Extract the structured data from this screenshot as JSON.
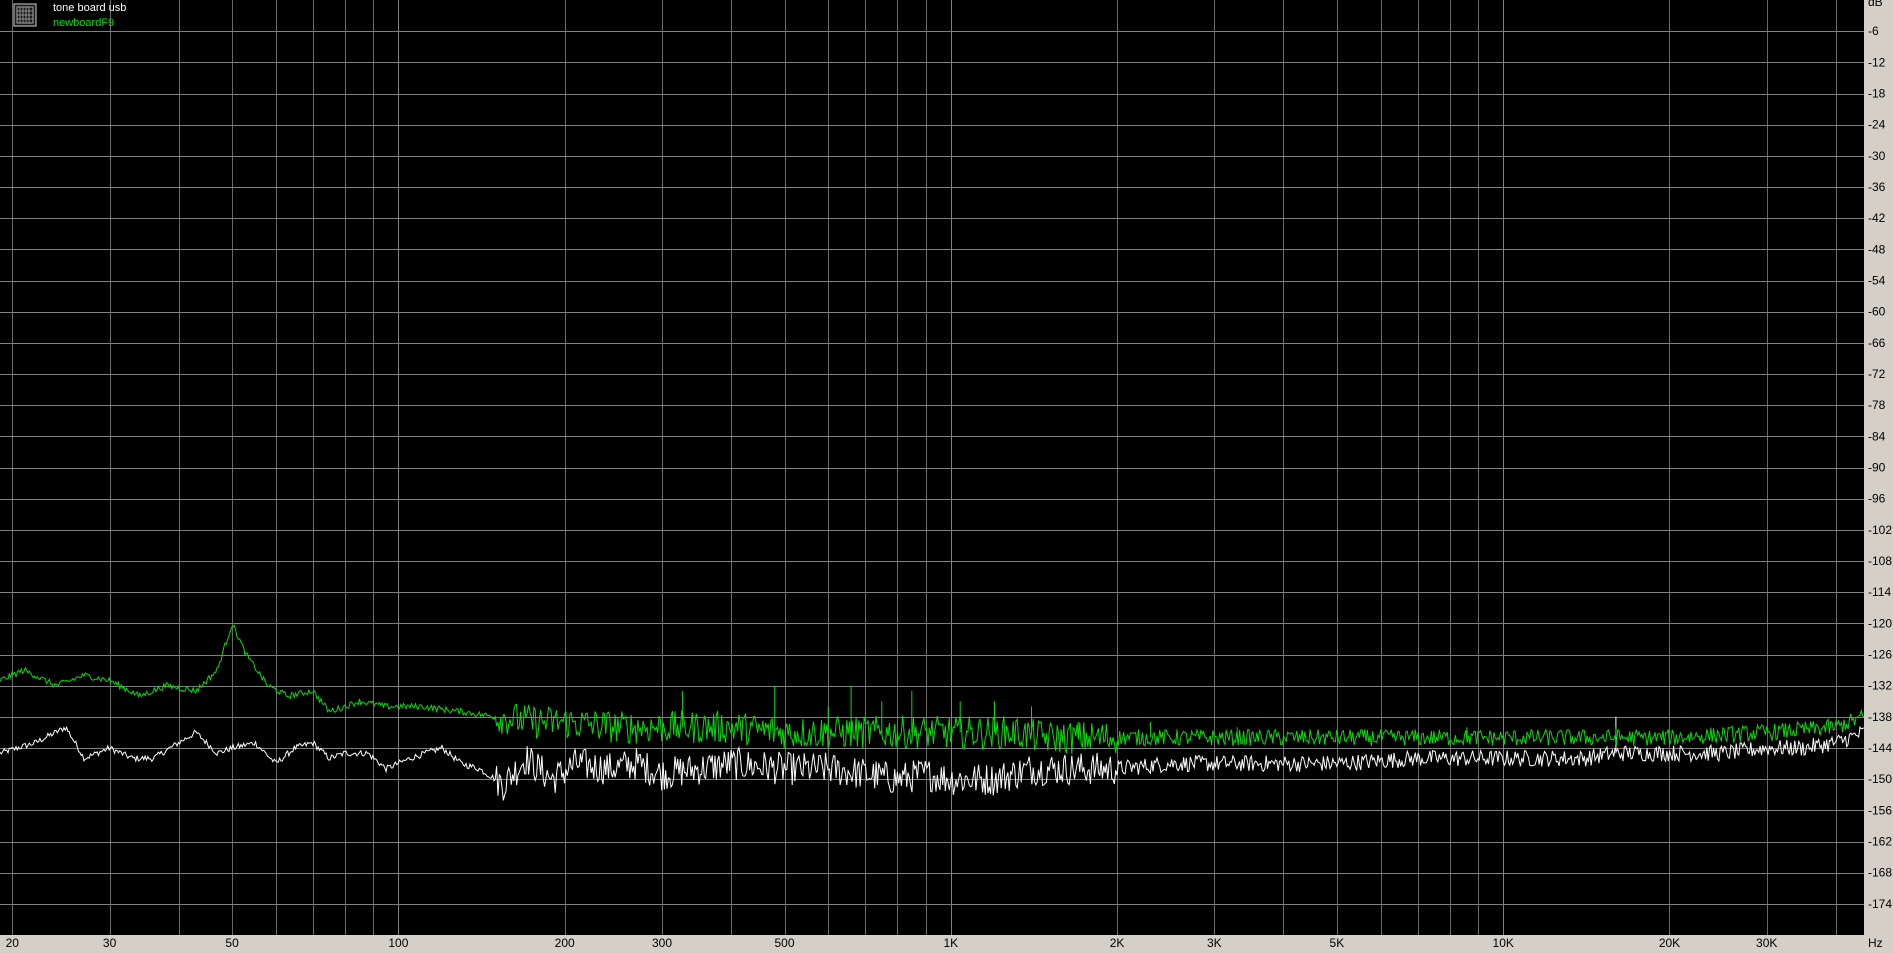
{
  "legend": {
    "icon": "spectrum-window-icon",
    "entries": [
      {
        "label": "tone board usb",
        "color": "#ffffff"
      },
      {
        "label": "newboardF9",
        "color": "#00e000"
      }
    ]
  },
  "colors": {
    "plot_background": "#000000",
    "axis_panel": "#d4d0c8",
    "grid": "#808080"
  },
  "chart_data": {
    "type": "line",
    "title": "",
    "xlabel": "",
    "ylabel": "",
    "x_unit_label": "Hz",
    "x_scale": "log",
    "xlim": [
      19,
      45000
    ],
    "ylim": [
      -180,
      0
    ],
    "grid": true,
    "legend_position": "top-left",
    "x_ticks": [
      {
        "value": 20,
        "label": "20"
      },
      {
        "value": 30,
        "label": "30"
      },
      {
        "value": 50,
        "label": "50"
      },
      {
        "value": 100,
        "label": "100"
      },
      {
        "value": 200,
        "label": "200"
      },
      {
        "value": 300,
        "label": "300"
      },
      {
        "value": 500,
        "label": "500"
      },
      {
        "value": 1000,
        "label": "1K"
      },
      {
        "value": 2000,
        "label": "2K"
      },
      {
        "value": 3000,
        "label": "3K"
      },
      {
        "value": 5000,
        "label": "5K"
      },
      {
        "value": 10000,
        "label": "10K"
      },
      {
        "value": 20000,
        "label": "20K"
      },
      {
        "value": 30000,
        "label": "30K"
      }
    ],
    "y_ticks": [
      "dB",
      "-6",
      "-12",
      "-18",
      "-24",
      "-30",
      "-36",
      "-42",
      "-48",
      "-54",
      "-60",
      "-66",
      "-72",
      "-78",
      "-84",
      "-90",
      "-96",
      "-102",
      "-108",
      "-114",
      "-120",
      "-126",
      "-132",
      "-138",
      "-144",
      "-150",
      "-156",
      "-162",
      "-168",
      "-174"
    ],
    "series": [
      {
        "name": "tone board usb",
        "color": "#ffffff",
        "points": [
          [
            19,
            -145
          ],
          [
            22,
            -143
          ],
          [
            25,
            -140
          ],
          [
            27,
            -146
          ],
          [
            30,
            -144
          ],
          [
            33,
            -146
          ],
          [
            36,
            -146
          ],
          [
            40,
            -143
          ],
          [
            43,
            -141
          ],
          [
            47,
            -145
          ],
          [
            50,
            -144
          ],
          [
            55,
            -143
          ],
          [
            60,
            -147
          ],
          [
            65,
            -144
          ],
          [
            70,
            -143
          ],
          [
            75,
            -146
          ],
          [
            80,
            -145
          ],
          [
            88,
            -145
          ],
          [
            95,
            -148
          ],
          [
            105,
            -146
          ],
          [
            112,
            -145
          ],
          [
            120,
            -144
          ],
          [
            130,
            -147
          ],
          [
            140,
            -148
          ],
          [
            155,
            -151
          ],
          [
            170,
            -146
          ],
          [
            190,
            -150
          ],
          [
            210,
            -147
          ],
          [
            240,
            -148
          ],
          [
            270,
            -147
          ],
          [
            300,
            -149
          ],
          [
            350,
            -148
          ],
          [
            400,
            -147
          ],
          [
            500,
            -148
          ],
          [
            600,
            -148
          ],
          [
            700,
            -149
          ],
          [
            800,
            -150
          ],
          [
            900,
            -149
          ],
          [
            1000,
            -150
          ],
          [
            1200,
            -150
          ],
          [
            1400,
            -148
          ],
          [
            1700,
            -148
          ],
          [
            2000,
            -148
          ],
          [
            2500,
            -147
          ],
          [
            3000,
            -147
          ],
          [
            4000,
            -147
          ],
          [
            5000,
            -147
          ],
          [
            7000,
            -146
          ],
          [
            10000,
            -146
          ],
          [
            14000,
            -146
          ],
          [
            16000,
            -145
          ],
          [
            20000,
            -145
          ],
          [
            25000,
            -145
          ],
          [
            30000,
            -144
          ],
          [
            35000,
            -144
          ],
          [
            40000,
            -143
          ],
          [
            45000,
            -141
          ]
        ],
        "spikes": [
          [
            16000,
            -138
          ]
        ]
      },
      {
        "name": "newboardF9",
        "color": "#00e000",
        "points": [
          [
            19,
            -131
          ],
          [
            21,
            -129
          ],
          [
            24,
            -132
          ],
          [
            27,
            -130
          ],
          [
            30,
            -131
          ],
          [
            34,
            -134
          ],
          [
            38,
            -132
          ],
          [
            43,
            -133
          ],
          [
            47,
            -129
          ],
          [
            50,
            -120
          ],
          [
            53,
            -126
          ],
          [
            58,
            -132
          ],
          [
            63,
            -134
          ],
          [
            70,
            -133
          ],
          [
            75,
            -137
          ],
          [
            80,
            -136
          ],
          [
            85,
            -135
          ],
          [
            95,
            -136
          ],
          [
            110,
            -136
          ],
          [
            130,
            -137
          ],
          [
            150,
            -138
          ],
          [
            180,
            -139
          ],
          [
            200,
            -139
          ],
          [
            250,
            -140
          ],
          [
            300,
            -140
          ],
          [
            400,
            -140
          ],
          [
            500,
            -141
          ],
          [
            700,
            -141
          ],
          [
            1000,
            -141
          ],
          [
            1300,
            -141
          ],
          [
            1500,
            -142
          ],
          [
            2000,
            -142
          ],
          [
            3000,
            -142
          ],
          [
            5000,
            -142
          ],
          [
            10000,
            -142
          ],
          [
            20000,
            -142
          ],
          [
            30000,
            -141
          ],
          [
            40000,
            -140
          ],
          [
            45000,
            -138
          ]
        ],
        "spikes": [
          [
            327,
            -133
          ],
          [
            480,
            -132
          ],
          [
            600,
            -136
          ],
          [
            660,
            -132
          ],
          [
            750,
            -135
          ],
          [
            850,
            -133
          ],
          [
            1040,
            -135
          ],
          [
            1200,
            -135
          ],
          [
            1400,
            -136
          ],
          [
            1700,
            -139
          ],
          [
            2300,
            -139
          ],
          [
            3300,
            -140
          ],
          [
            8600,
            -140
          ],
          [
            16000,
            -140
          ]
        ]
      }
    ]
  }
}
